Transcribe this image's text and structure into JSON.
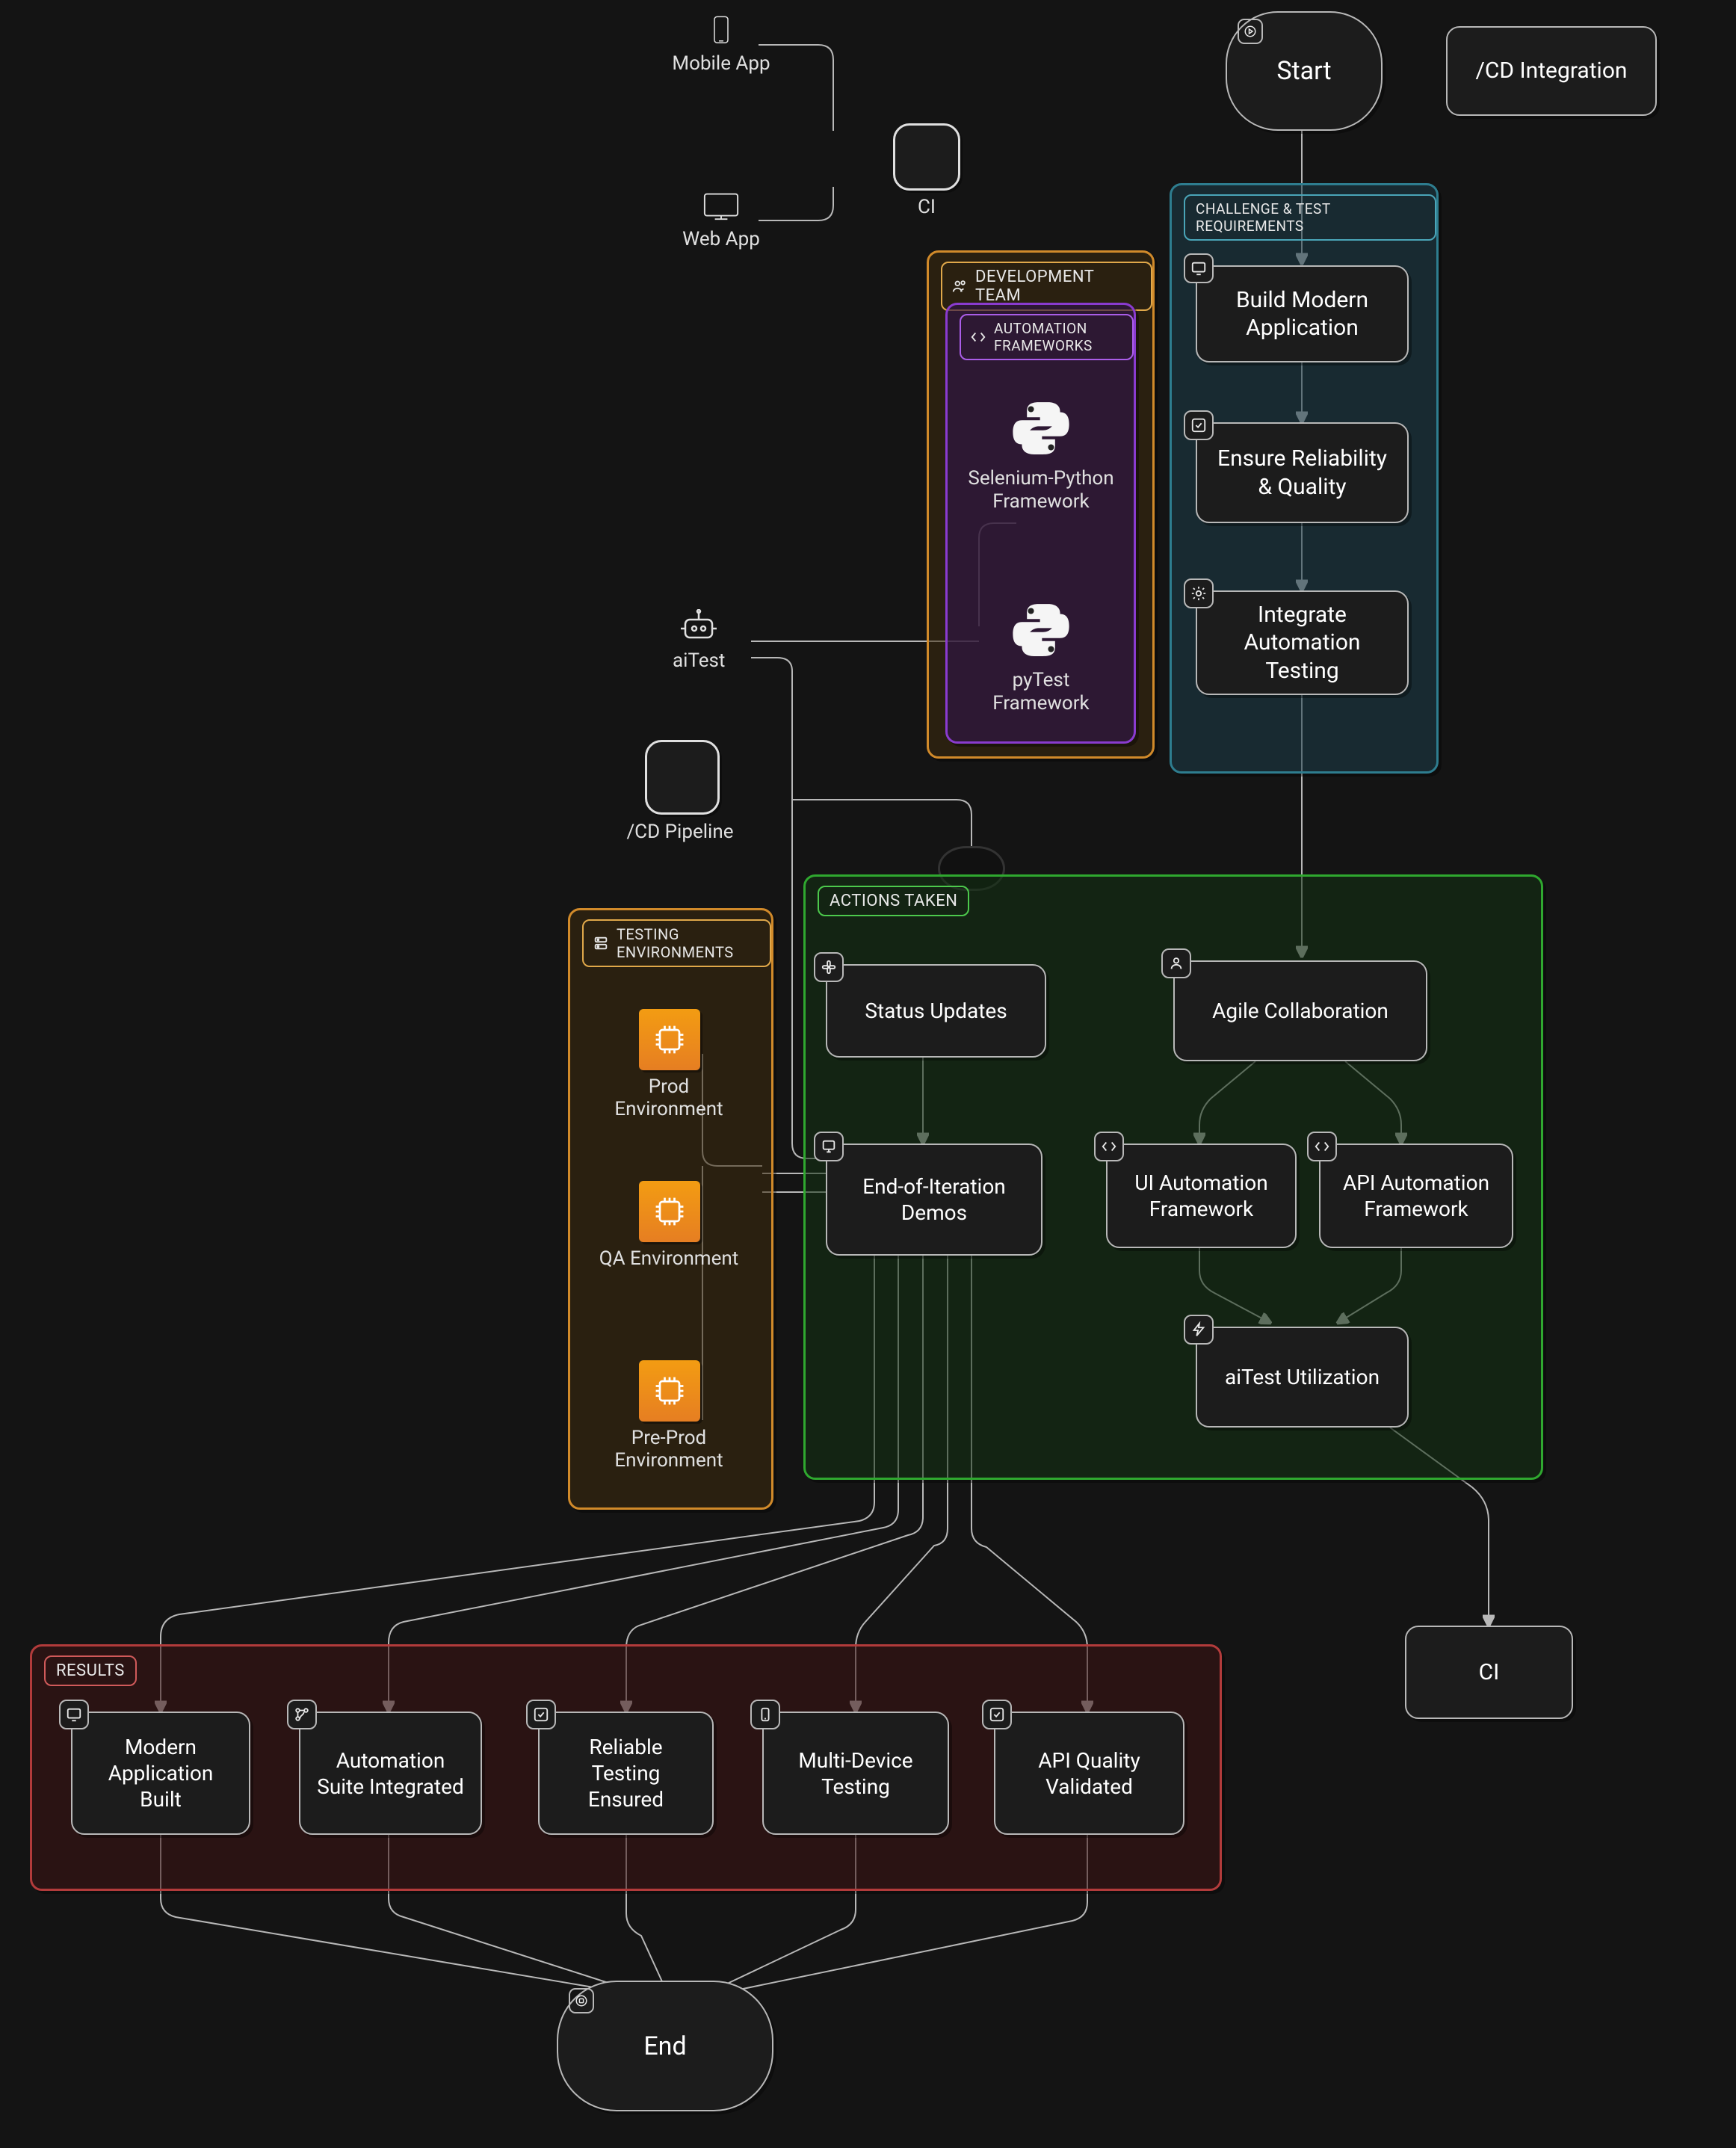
{
  "terminals": {
    "start": "Start",
    "end": "End"
  },
  "top_nodes": {
    "cd_integration": "/CD Integration",
    "ci_top": "CI"
  },
  "devices": {
    "mobile": "Mobile App",
    "web": "Web App",
    "aitest": "aiTest",
    "cd_pipeline": "/CD Pipeline"
  },
  "groups": {
    "challenge": {
      "title": "CHALLENGE & TEST REQUIREMENTS",
      "build": "Build Modern Application",
      "ensure": "Ensure Reliability & Quality",
      "integrate": "Integrate Automation Testing"
    },
    "dev_team": {
      "title": "DEVELOPMENT TEAM"
    },
    "auto_fw": {
      "title": "AUTOMATION FRAMEWORKS",
      "selenium": "Selenium-Python Framework",
      "pytest": "pyTest Framework"
    },
    "test_envs": {
      "title": "TESTING ENVIRONMENTS",
      "prod": "Prod Environment",
      "qa": "QA Environment",
      "preprod": "Pre-Prod Environment"
    },
    "actions": {
      "title": "ACTIONS TAKEN",
      "status": "Status Updates",
      "agile": "Agile Collaboration",
      "demos": "End-of-Iteration Demos",
      "ui_fw": "UI Automation Framework",
      "api_fw": "API Automation Framework",
      "aitest_util": "aiTest Utilization"
    },
    "results": {
      "title": "RESULTS",
      "built": "Modern Application Built",
      "suite": "Automation Suite Integrated",
      "reliable": "Reliable Testing Ensured",
      "multi": "Multi-Device Testing",
      "api_q": "API Quality Validated"
    }
  },
  "right_ci": "CI"
}
